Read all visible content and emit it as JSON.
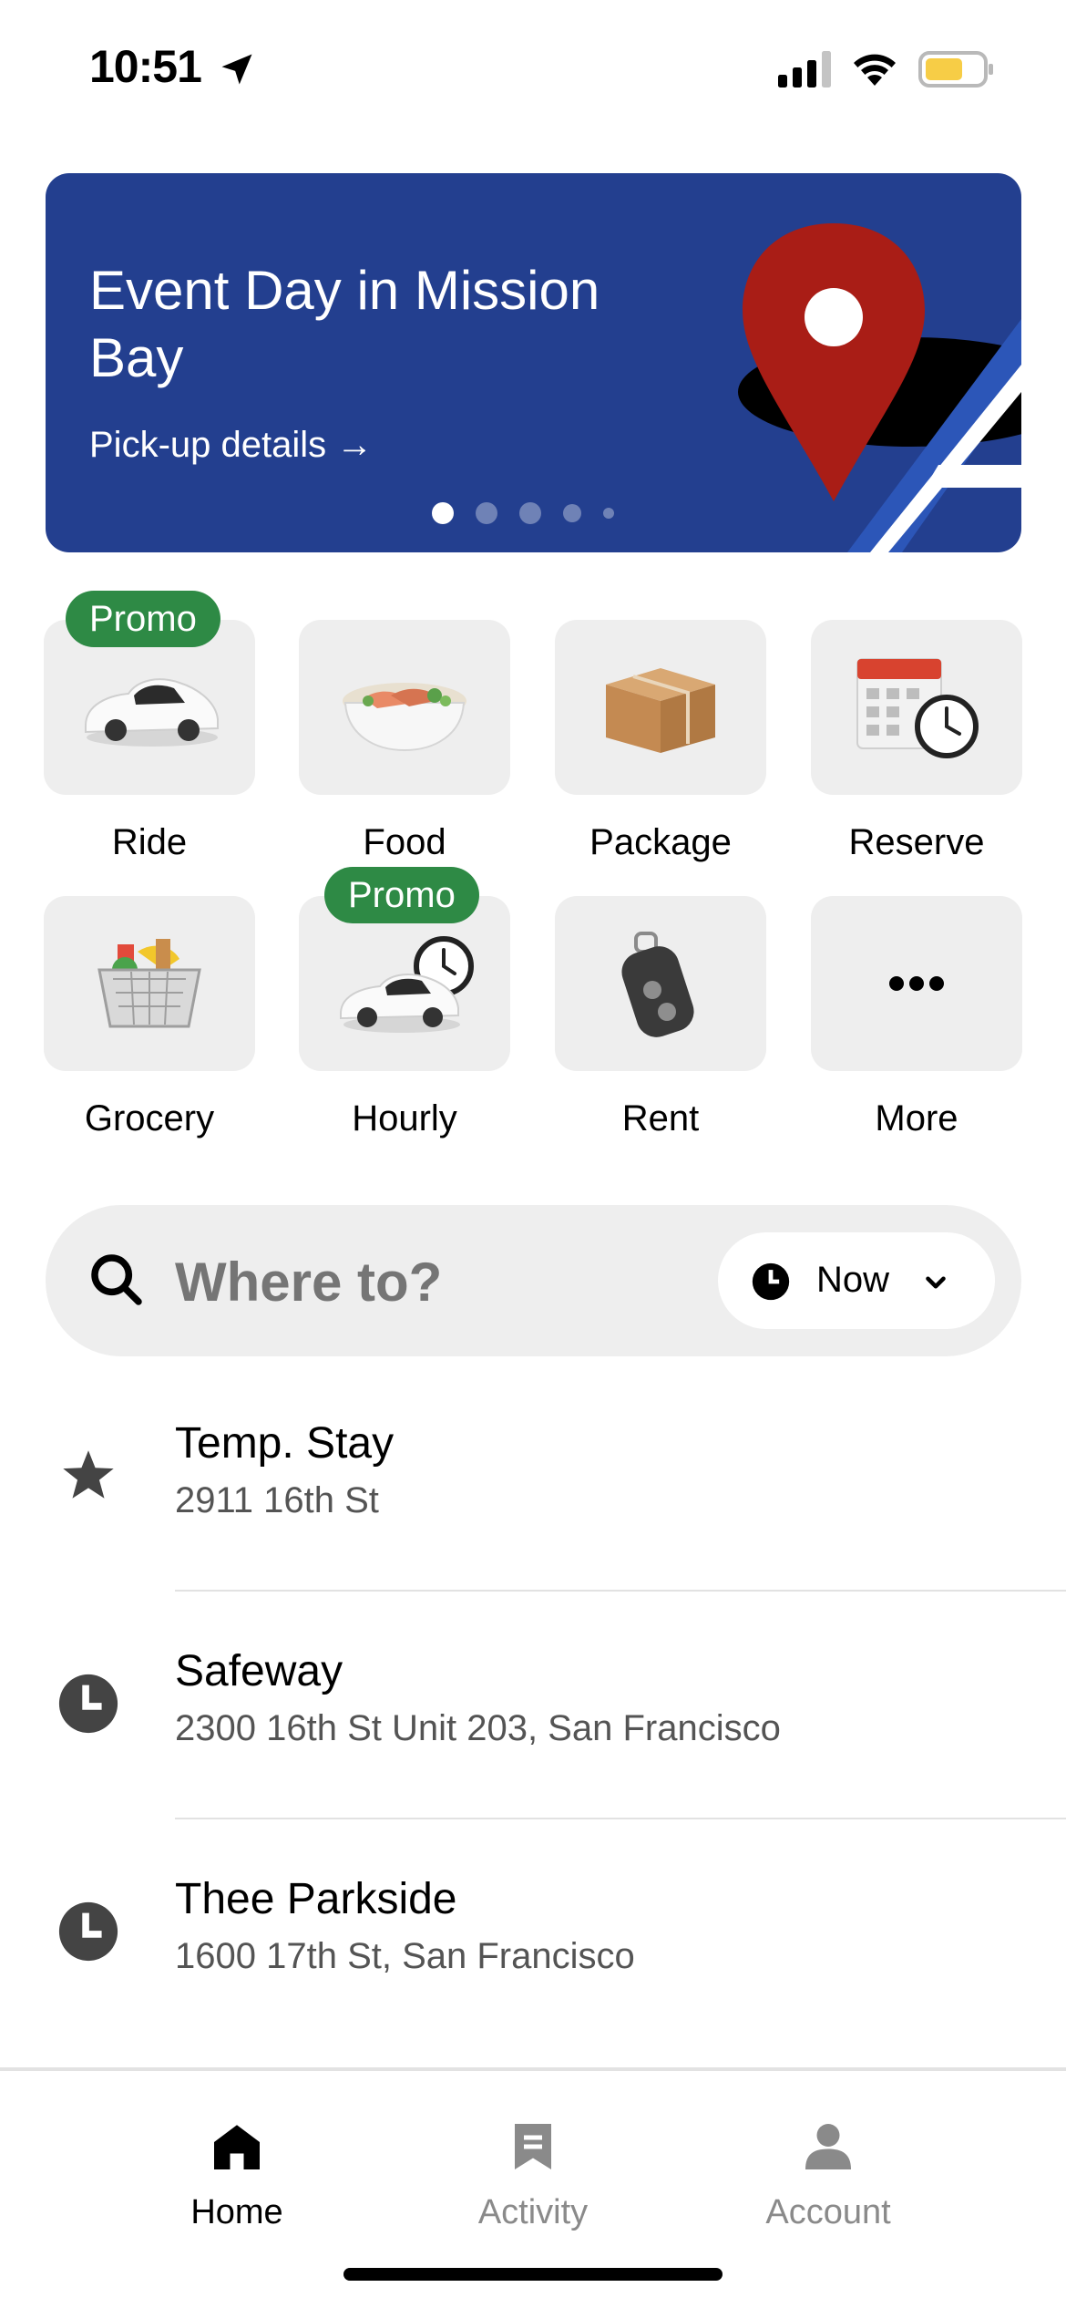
{
  "status_bar": {
    "time": "10:51",
    "icons": [
      "location-arrow-icon",
      "cellular-signal-icon",
      "wifi-icon",
      "battery-icon"
    ]
  },
  "banner": {
    "title": "Event Day in Mission Bay",
    "link": "Pick-up details →",
    "colors": {
      "background": "#233f8f",
      "pin": "#a91d16"
    },
    "page_count": 5,
    "active_page": 1
  },
  "services": [
    {
      "label": "Ride",
      "badge": "Promo",
      "icon": "car-icon"
    },
    {
      "label": "Food",
      "badge": "",
      "icon": "food-bowl-icon"
    },
    {
      "label": "Package",
      "badge": "",
      "icon": "package-box-icon"
    },
    {
      "label": "Reserve",
      "badge": "",
      "icon": "calendar-clock-icon"
    },
    {
      "label": "Grocery",
      "badge": "",
      "icon": "grocery-basket-icon"
    },
    {
      "label": "Hourly",
      "badge": "Promo",
      "icon": "car-clock-icon"
    },
    {
      "label": "Rent",
      "badge": "",
      "icon": "car-key-icon"
    },
    {
      "label": "More",
      "badge": "",
      "icon": "more-dots-icon"
    }
  ],
  "search": {
    "placeholder": "Where to?",
    "time_option": "Now"
  },
  "places": [
    {
      "name": "Temp. Stay",
      "address": "2911 16th St",
      "icon": "star-icon"
    },
    {
      "name": "Safeway",
      "address": "2300 16th St Unit 203, San Francisco",
      "icon": "clock-icon"
    },
    {
      "name": "Thee Parkside",
      "address": "1600 17th St, San Francisco",
      "icon": "clock-icon"
    }
  ],
  "tabs": [
    {
      "label": "Home",
      "active": true,
      "icon": "home-icon"
    },
    {
      "label": "Activity",
      "active": false,
      "icon": "receipt-icon"
    },
    {
      "label": "Account",
      "active": false,
      "icon": "person-icon"
    }
  ],
  "colors": {
    "promo_badge": "#2e8a45",
    "tile_bg": "#eeeeee",
    "inactive_tab": "#8a8a8a"
  }
}
